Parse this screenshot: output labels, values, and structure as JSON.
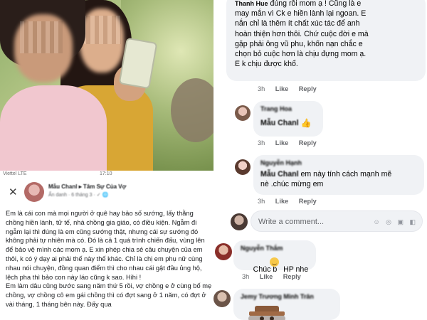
{
  "post": {
    "status_left": "Viettel LTE",
    "status_mid": "17:10",
    "author_name": "Mẫu Chanl",
    "author_suffix": "▸ Tâm Sự Của Vợ",
    "subline": "Ẩn danh · 6 tháng 3 · ✓ 🌐",
    "body": "Em là cái con mà mọi người ở quê hay bảo số sướng, lấy thằng chồng hiền lành, tử tế, nhà chồng gia giáo, có điều kiện. Ngẫm đi ngẫm lại thì đúng là em cũng sướng thật, nhưng cái sự sướng đó không phải tự nhiên mà có. Đó là cả 1 quá trình chiến đấu, vùng lên để bảo vệ mình các mom ạ. E xin phép chia sẻ câu chuyện của em thôi, k có ý dạy ai phải thế này thế khác. Chỉ là chị em phụ nữ cùng nhau nói chuyện, đồng quan điểm thì cho nhau cái gật đầu ủng hộ, lệch pha thì bảo con này láo cũng k sao. Hihi !\nEm làm dâu cũng bước sang năm thứ 5 rồi, vợ chồng e ở cùng bố mẹ chồng, vợ chồng cô em gái chồng thì có đợt sang ở 1 năm, có đợt ở vài tháng, 1 tháng bên này. Đấy qua"
  },
  "comments": [
    {
      "author": "Thanh Hue",
      "text_lines": [
        "đúng rồi mom ạ ! Cũng là e",
        "may mắn vì Ck e hiền lành lại ngoan. E",
        "nắn chỉ là thêm ít chất xúc tác để anh",
        "hoàn thiện hơn thôi. Chứ cuộc đời e mà",
        "gặp phải ông vũ phu, khốn nạn chắc e",
        "chọn bỏ cuộc hơn là chịu đựng mom ạ.",
        "E k chịu được khổ."
      ],
      "time": "3h",
      "like": "Like",
      "reply": "Reply"
    },
    {
      "author": "Trang Hoa",
      "mention": "Mẫu Chanl",
      "text": "",
      "time": "3h",
      "like": "Like",
      "reply": "Reply"
    },
    {
      "author": "Nguyễn Hạnh",
      "mention": "Mẫu Chanl",
      "text_lines": [
        "em này tính cách mạnh mẽ",
        "nè .chúc mừng em"
      ],
      "time": "3h",
      "like": "Like",
      "reply": "Reply"
    },
    {
      "author": "Nguyễn Thắm",
      "text": "Chúc b   HP nhe",
      "time": "3h",
      "like": "Like",
      "reply": "Reply"
    },
    {
      "author": "Jemy Trương Minh Trân"
    }
  ],
  "write_comment": {
    "placeholder": "Write a comment..."
  },
  "colors": {
    "bubble": "#f0f2f5",
    "meta": "#65676b",
    "text": "#050505"
  }
}
